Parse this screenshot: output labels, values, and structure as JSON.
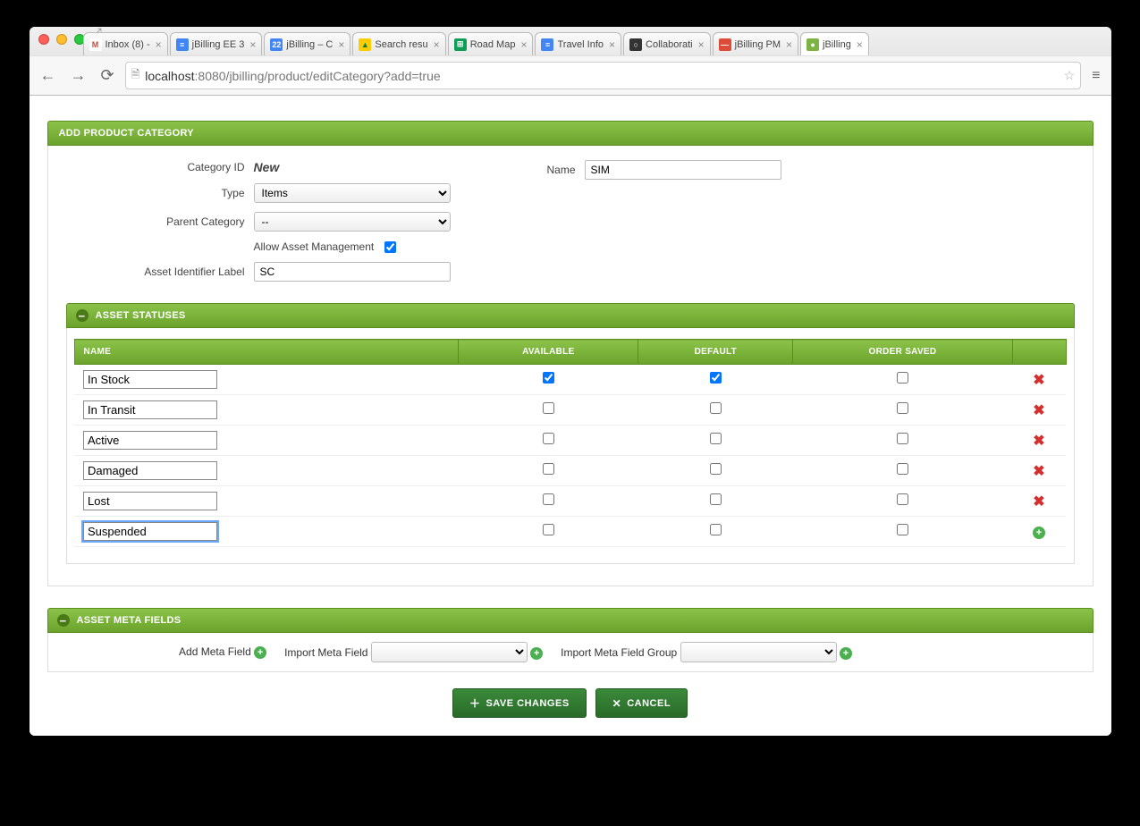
{
  "browser": {
    "tabs": [
      {
        "label": "Inbox (8) - ",
        "favicon_bg": "#fff",
        "favicon_text": "M",
        "favicon_color": "#d14836"
      },
      {
        "label": "jBilling EE 3",
        "favicon_bg": "#4285f4",
        "favicon_text": "≡",
        "favicon_color": "#fff"
      },
      {
        "label": "jBilling – C",
        "favicon_bg": "#4285f4",
        "favicon_text": "22",
        "favicon_color": "#fff"
      },
      {
        "label": "Search resu",
        "favicon_bg": "#ffcc00",
        "favicon_text": "▲",
        "favicon_color": "#0b7d3c"
      },
      {
        "label": "Road Map",
        "favicon_bg": "#0f9d58",
        "favicon_text": "⊞",
        "favicon_color": "#fff"
      },
      {
        "label": "Travel Info",
        "favicon_bg": "#4285f4",
        "favicon_text": "≡",
        "favicon_color": "#fff"
      },
      {
        "label": "Collaborati",
        "favicon_bg": "#333",
        "favicon_text": "○",
        "favicon_color": "#fff"
      },
      {
        "label": "jBilling PM",
        "favicon_bg": "#dd4b39",
        "favicon_text": "—",
        "favicon_color": "#fff"
      },
      {
        "label": "jBilling",
        "favicon_bg": "#7cb342",
        "favicon_text": "●",
        "favicon_color": "#fff",
        "active": true
      }
    ],
    "url_host": "localhost",
    "url_path": ":8080/jbilling/product/editCategory?add=true"
  },
  "form": {
    "header": "ADD PRODUCT CATEGORY",
    "fields": {
      "category_id_label": "Category ID",
      "category_id_value": "New",
      "name_label": "Name",
      "name_value": "SIM",
      "type_label": "Type",
      "type_value": "Items",
      "parent_label": "Parent Category",
      "parent_value": "--",
      "allow_asset_label": "Allow Asset Management",
      "allow_asset_checked": true,
      "asset_ident_label": "Asset Identifier Label",
      "asset_ident_value": "SC"
    }
  },
  "statuses": {
    "header": "ASSET STATUSES",
    "columns": {
      "name": "NAME",
      "available": "AVAILABLE",
      "default": "DEFAULT",
      "order_saved": "ORDER SAVED"
    },
    "rows": [
      {
        "name": "In Stock",
        "available": true,
        "default": true,
        "order_saved": false,
        "action": "delete"
      },
      {
        "name": "In Transit",
        "available": false,
        "default": false,
        "order_saved": false,
        "action": "delete"
      },
      {
        "name": "Active",
        "available": false,
        "default": false,
        "order_saved": false,
        "action": "delete"
      },
      {
        "name": "Damaged",
        "available": false,
        "default": false,
        "order_saved": false,
        "action": "delete"
      },
      {
        "name": "Lost",
        "available": false,
        "default": false,
        "order_saved": false,
        "action": "delete"
      },
      {
        "name": "Suspended",
        "available": false,
        "default": false,
        "order_saved": false,
        "action": "add",
        "focused": true
      }
    ]
  },
  "meta": {
    "header": "ASSET META FIELDS",
    "add_label": "Add Meta Field",
    "import_label": "Import Meta Field",
    "import_group_label": "Import Meta Field Group"
  },
  "actions": {
    "save": "SAVE CHANGES",
    "cancel": "CANCEL"
  }
}
